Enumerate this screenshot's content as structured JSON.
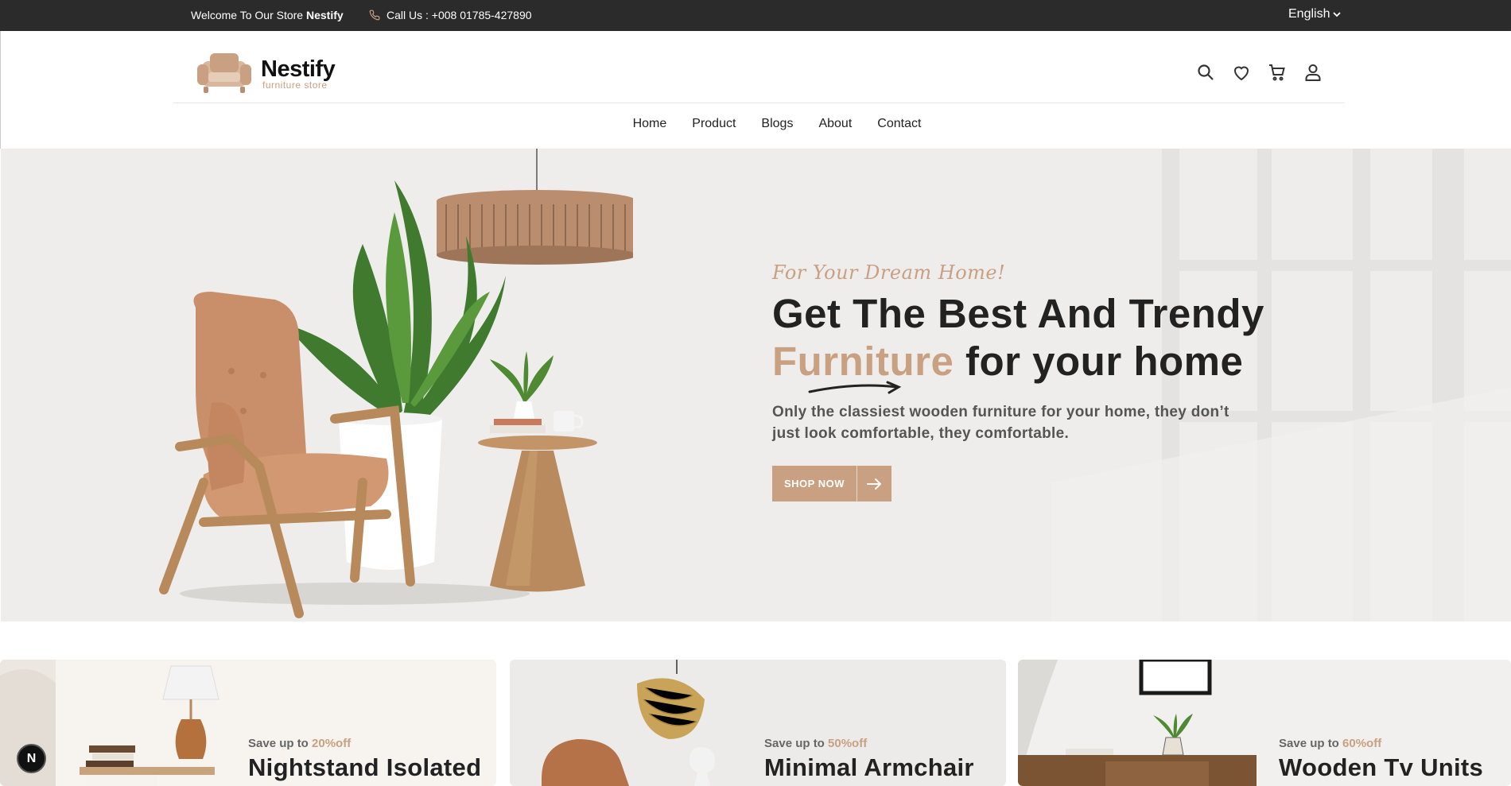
{
  "topbar": {
    "welcome_prefix": "Welcome To Our Store",
    "store_name": "Nestify",
    "call_text": "Call Us : +008 01785-427890",
    "language": "English"
  },
  "header": {
    "brand_name": "Nestify",
    "brand_sub": "furniture store",
    "icons": [
      "search-icon",
      "heart-icon",
      "cart-icon",
      "user-icon"
    ]
  },
  "nav": {
    "items": [
      "Home",
      "Product",
      "Blogs",
      "About",
      "Contact"
    ]
  },
  "hero": {
    "tagline": "For Your Dream Home!",
    "headline_line1": "Get The Best And Trendy",
    "headline_accent": "Furniture",
    "headline_line2_rest": " for your home",
    "description": "Only the classiest wooden furniture for your home, they don’t just look comfortable, they comfortable.",
    "button_label": "SHOP NOW"
  },
  "cards": [
    {
      "save_prefix": "Save up to",
      "save_pct": "20%off",
      "title": "Nightstand Isolated"
    },
    {
      "save_prefix": "Save up to",
      "save_pct": "50%off",
      "title": "Minimal Armchair"
    },
    {
      "save_prefix": "Save up to",
      "save_pct": "60%off",
      "title": "Wooden Tv Units"
    }
  ],
  "badge": {
    "letter": "N"
  },
  "colors": {
    "accent": "#c9a082",
    "topbar": "#2b2b2b",
    "hero_bg": "#eeedeb"
  }
}
